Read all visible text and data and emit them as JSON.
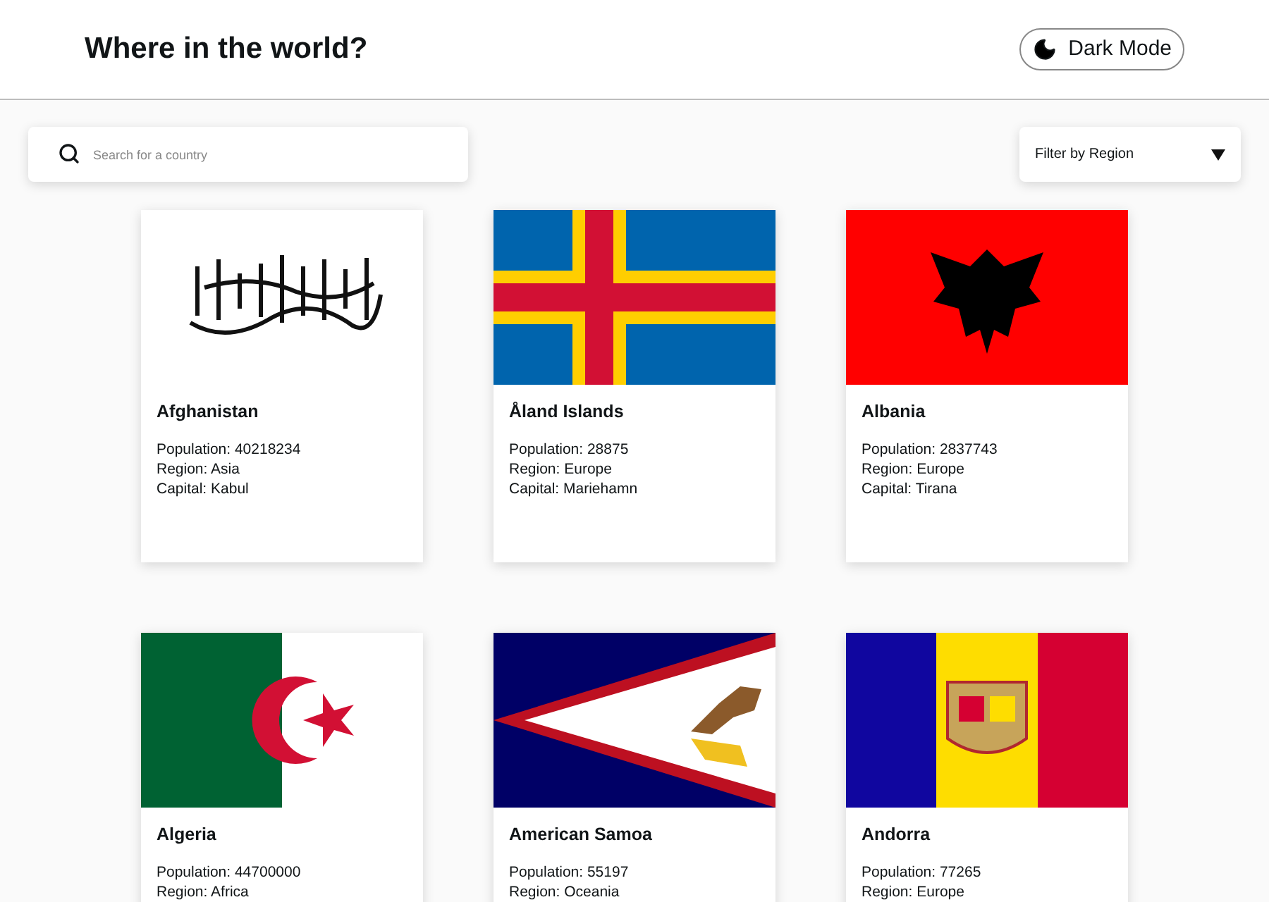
{
  "header": {
    "title": "Where in the world?",
    "theme_toggle": {
      "label": "Dark Mode"
    }
  },
  "search": {
    "placeholder": "Search for a country"
  },
  "region_filter": {
    "label": "Filter by Region"
  },
  "countries": [
    {
      "name": "Afghanistan",
      "lines": [
        "Population: 40218234",
        "Region: Asia",
        "Capital: Kabul"
      ]
    },
    {
      "name": "Åland Islands",
      "lines": [
        "Population: 28875",
        "Region: Europe",
        "Capital: Mariehamn"
      ]
    },
    {
      "name": "Albania",
      "lines": [
        "Population: 2837743",
        "Region: Europe",
        "Capital: Tirana"
      ]
    },
    {
      "name": "Algeria",
      "lines": [
        "Population: 44700000",
        "Region: Africa"
      ]
    },
    {
      "name": "American Samoa",
      "lines": [
        "Population: 55197",
        "Region: Oceania"
      ]
    },
    {
      "name": "Andorra",
      "lines": [
        "Population: 77265",
        "Region: Europe"
      ]
    }
  ]
}
